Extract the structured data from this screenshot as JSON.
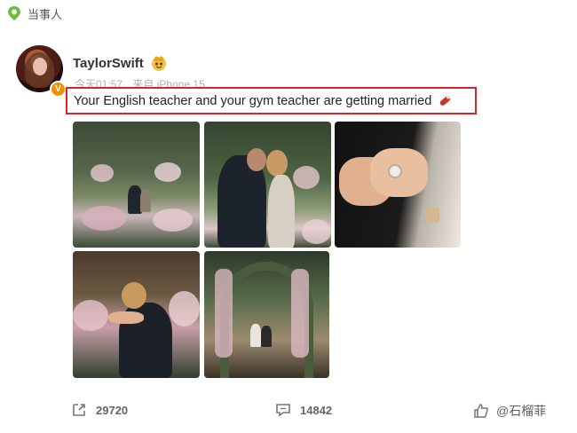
{
  "topbar": {
    "label": "当事人",
    "icon": "location-pin-icon"
  },
  "post": {
    "username": "TaylorSwift",
    "member_badge_icon": "vip-crown-icon",
    "verified_badge": "V",
    "time": "今天01:57",
    "source": "来自 iPhone 15",
    "text": "Your English teacher and your gym teacher are getting married",
    "emoji_icon": "ring-emoji-icon",
    "highlight_color": "#d7232b",
    "photos": [
      {
        "alt": "couple-kneeling-in-garden"
      },
      {
        "alt": "couple-embracing-in-garden"
      },
      {
        "alt": "engagement-ring-hands"
      },
      {
        "alt": "couple-hugging-among-flowers"
      },
      {
        "alt": "garden-flower-arch"
      }
    ]
  },
  "actions": {
    "share_count": "29720",
    "comment_count": "14842",
    "watermark": "@石榴菲"
  },
  "colors": {
    "accent": "#f29000",
    "pin_green": "#6abf3a"
  }
}
